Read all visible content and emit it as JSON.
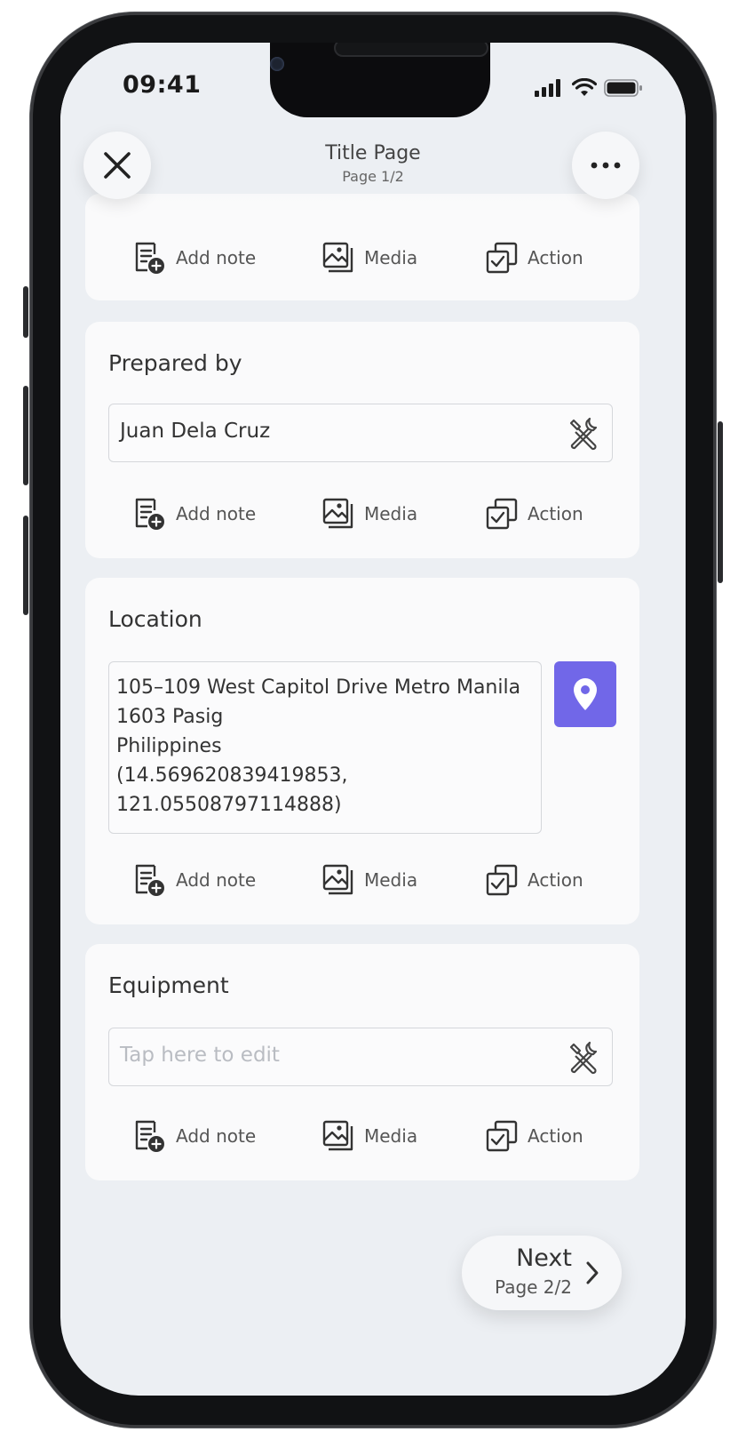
{
  "status": {
    "time": "09:41"
  },
  "header": {
    "title": "Title Page",
    "subtitle": "Page 1/2"
  },
  "actions": {
    "add_note": "Add note",
    "media": "Media",
    "action": "Action"
  },
  "prepared_by": {
    "label": "Prepared by",
    "value": "Juan Dela Cruz"
  },
  "location": {
    "label": "Location",
    "lines": [
      "105–109 West Capitol Drive Metro Manila",
      "1603 Pasig",
      "Philippines",
      "(14.569620839419853,",
      "121.05508797114888)"
    ]
  },
  "equipment": {
    "label": "Equipment",
    "placeholder": "Tap here to edit"
  },
  "next": {
    "label": "Next",
    "page": "Page 2/2"
  },
  "colors": {
    "accent": "#7167e8",
    "screen_bg": "#eceff3",
    "card_bg": "#fafafb"
  }
}
